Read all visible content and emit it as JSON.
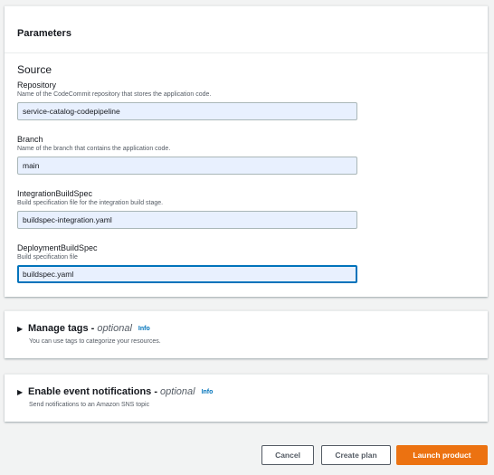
{
  "parameters": {
    "title": "Parameters",
    "section_title": "Source",
    "fields": [
      {
        "label": "Repository",
        "description": "Name of the CodeCommit repository that stores the application code.",
        "value": "service-catalog-codepipeline"
      },
      {
        "label": "Branch",
        "description": "Name of the branch that contains the application code.",
        "value": "main"
      },
      {
        "label": "IntegrationBuildSpec",
        "description": "Build specification file for the integration build stage.",
        "value": "buildspec-integration.yaml"
      },
      {
        "label": "DeploymentBuildSpec",
        "description": "Build specification file",
        "value": "buildspec.yaml"
      }
    ]
  },
  "manage_tags": {
    "title": "Manage tags -",
    "optional": "optional",
    "info": "Info",
    "description": "You can use tags to categorize your resources."
  },
  "event_notifications": {
    "title": "Enable event notifications -",
    "optional": "optional",
    "info": "Info",
    "description": "Send notifications to an Amazon SNS topic"
  },
  "actions": {
    "cancel": "Cancel",
    "create_plan": "Create plan",
    "launch": "Launch product"
  },
  "colors": {
    "accent": "#ec7211",
    "link": "#0073bb",
    "input_bg": "#e8f0fe"
  },
  "icons": {
    "expand": "caret-right-icon"
  }
}
